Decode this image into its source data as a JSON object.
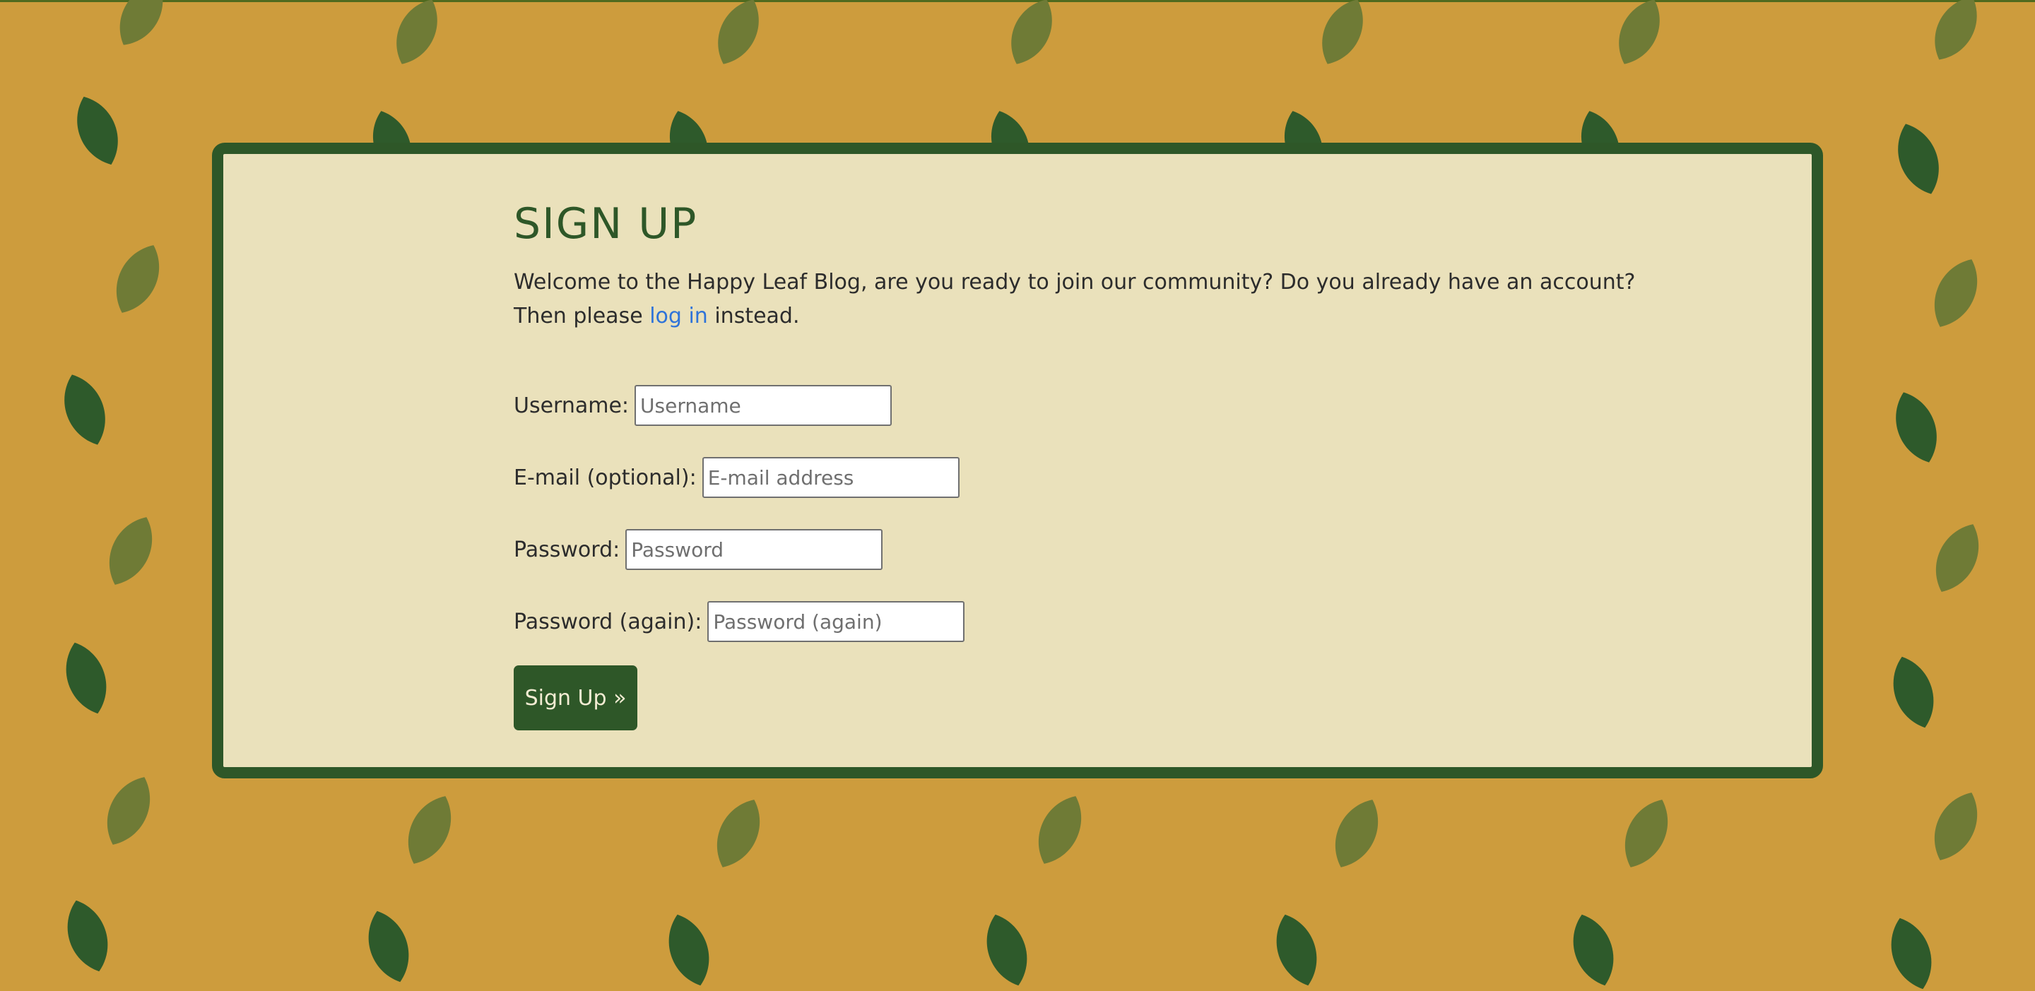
{
  "page": {
    "title": "SIGN UP",
    "intro": {
      "line1": "Welcome to the Happy Leaf Blog, are you ready to join our community? Do you already have an account?",
      "line2_before": "Then please ",
      "login_link": "log in",
      "line2_after": " instead."
    }
  },
  "form": {
    "username": {
      "label": "Username:",
      "placeholder": "Username",
      "value": ""
    },
    "email": {
      "label": "E-mail (optional):",
      "placeholder": "E-mail address",
      "value": ""
    },
    "password": {
      "label": "Password:",
      "placeholder": "Password",
      "value": ""
    },
    "password_again": {
      "label": "Password (again):",
      "placeholder": "Password (again)",
      "value": ""
    },
    "submit_label": "Sign Up »"
  },
  "colors": {
    "background": "#cd9c3d",
    "card_background": "#eae1bb",
    "accent_green": "#2e5728",
    "leaf_dark": "#2e5a2b",
    "leaf_olive": "#6f7b36",
    "link": "#2e73d9"
  },
  "icons": {
    "background_pattern": "leaf-icon"
  }
}
